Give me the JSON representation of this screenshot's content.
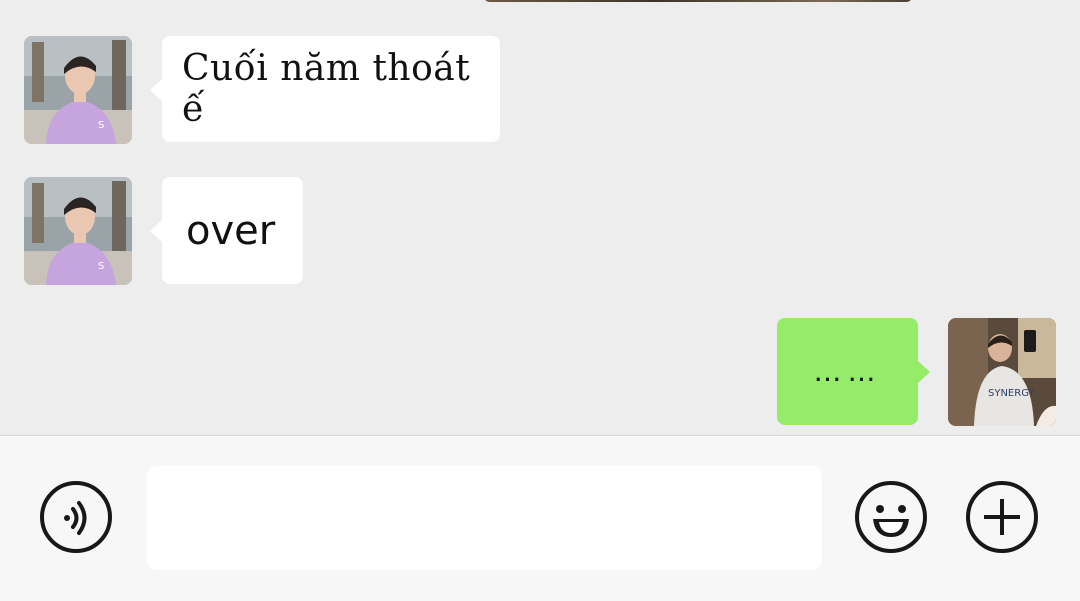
{
  "messages": [
    {
      "side": "left",
      "sender": "contact",
      "text": "Cuối năm thoát ế"
    },
    {
      "side": "left",
      "sender": "contact",
      "text": "over"
    },
    {
      "side": "right",
      "sender": "me",
      "text": "……"
    }
  ],
  "input": {
    "value": "",
    "placeholder": ""
  },
  "icons": {
    "voice": "voice-icon",
    "emoji": "emoji-icon",
    "add": "plus-icon"
  },
  "colors": {
    "chat_background": "#ededed",
    "incoming_bubble": "#ffffff",
    "outgoing_bubble": "#95ec69",
    "input_bar": "#f7f7f7",
    "icon_stroke": "#181818"
  }
}
